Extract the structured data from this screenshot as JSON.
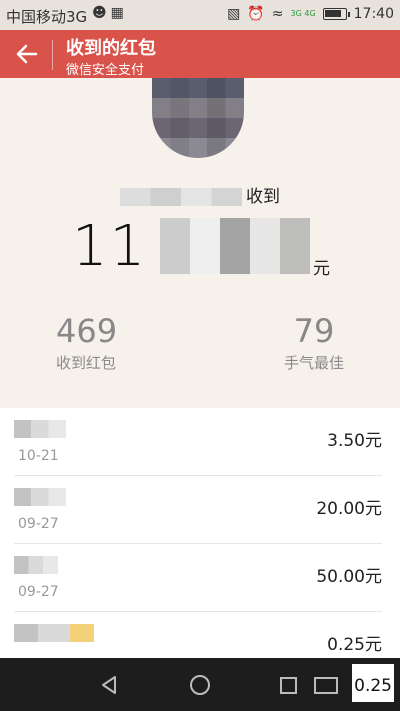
{
  "status_bar": {
    "carrier": "中国移动3G",
    "time": "17:40",
    "network_badge": "3G 4G"
  },
  "header": {
    "title": "收到的红包",
    "subtitle": "微信安全支付"
  },
  "summary": {
    "sender_suffix": "收到",
    "amount_visible": "11",
    "amount_unit": "元",
    "received_count": "469",
    "received_label": "收到红包",
    "best_luck_count": "79",
    "best_luck_label": "手气最佳"
  },
  "records": [
    {
      "name_visible": "",
      "date": "10-21",
      "amount": "3.50元"
    },
    {
      "name_visible": "",
      "date": "09-27",
      "amount": "20.00元"
    },
    {
      "name_visible": "",
      "date": "09-27",
      "amount": "50.00元"
    },
    {
      "name_visible": "",
      "date": "",
      "amount": "0.25元"
    }
  ],
  "overlay": {
    "badge_text": "0.25"
  }
}
